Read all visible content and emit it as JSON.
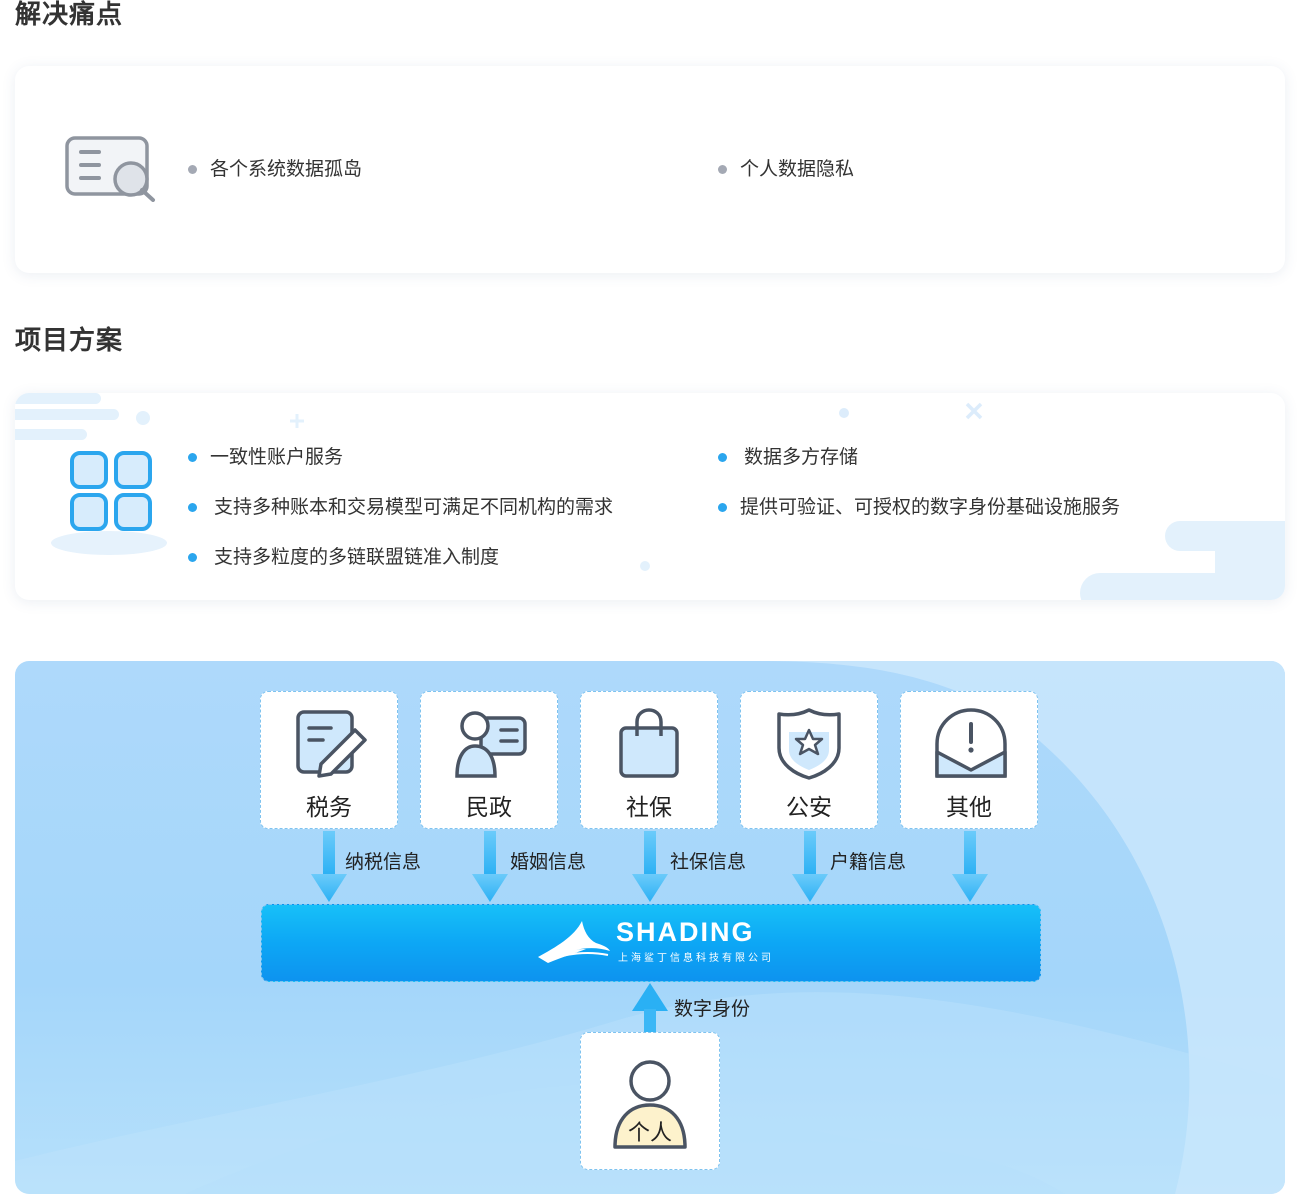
{
  "sections": {
    "pain_points_title": "解决痛点",
    "solution_title": "项目方案"
  },
  "pain_points": {
    "items": [
      "各个系统数据孤岛",
      "个人数据隐私"
    ]
  },
  "solution": {
    "left_items": [
      "一致性账户服务",
      "支持多种账本和交易模型可满足不同机构的需求",
      "支持多粒度的多链联盟链准入制度"
    ],
    "right_items": [
      "数据多方存储",
      "提供可验证、可授权的数字身份基础设施服务"
    ]
  },
  "diagram": {
    "sources": [
      {
        "label": "税务",
        "icon": "tax-form-pencil-icon"
      },
      {
        "label": "民政",
        "icon": "id-card-person-icon"
      },
      {
        "label": "社保",
        "icon": "bag-lock-icon"
      },
      {
        "label": "公安",
        "icon": "police-shield-star-icon"
      },
      {
        "label": "其他",
        "icon": "envelope-alert-icon"
      }
    ],
    "flows": [
      "纳税信息",
      "婚姻信息",
      "社保信息",
      "户籍信息"
    ],
    "platform": {
      "name": "SHADING",
      "company": "上海鲨丁信息科技有限公司"
    },
    "identity_label": "数字身份",
    "person_label": "个人"
  },
  "colors": {
    "accent_blue": "#2ba6ee",
    "bullet_gray": "#a4a9b4",
    "platform_blue": "#0da7f5",
    "diagram_bg": "#a4d6fa"
  }
}
